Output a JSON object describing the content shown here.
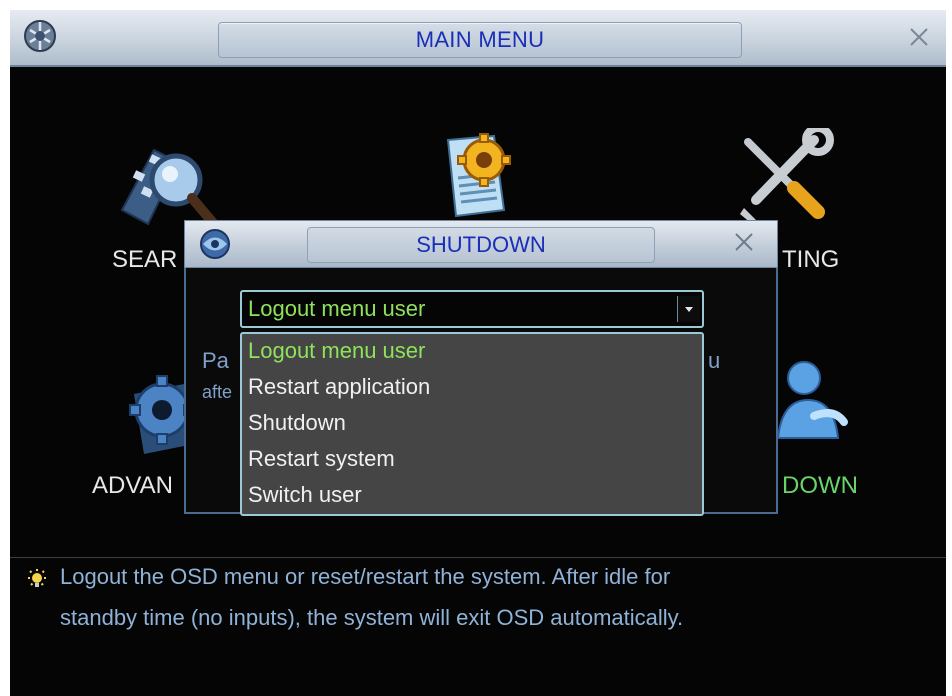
{
  "window": {
    "title": "MAIN MENU",
    "close_icon": "close-icon",
    "logo_icon": "dvr-logo-icon"
  },
  "menu": {
    "search_label": "SEAR",
    "setting_label": "TING",
    "advanced_label": "ADVAN",
    "shutdown_label": "DOWN",
    "icons": [
      "search-film-icon",
      "info-document-gear-icon",
      "tools-wrench-screwdriver-icon",
      "advanced-gear-icon",
      "shutdown-user-icon"
    ]
  },
  "dialog": {
    "title": "SHUTDOWN",
    "partial_text_line1": "Pa",
    "partial_text_line2": "afte",
    "partial_text_right": "u",
    "select": {
      "value": "Logout menu user"
    },
    "dropdown": {
      "options": [
        "Logout menu user",
        "Restart application",
        "Shutdown",
        "Restart system",
        "Switch user"
      ],
      "selected_index": 0
    }
  },
  "help": {
    "icon": "lightbulb-hint-icon",
    "line1": "Logout the OSD menu or reset/restart the system. After idle for",
    "line2": "standby time (no inputs), the system will exit OSD automatically."
  },
  "colors": {
    "title_text": "#1a2eb8",
    "selected_text": "#8ee35b",
    "help_text": "#8fb2d6",
    "label_text": "#e8e8e8",
    "dropdown_bg": "#454545",
    "accent_border": "#9bcad6"
  }
}
